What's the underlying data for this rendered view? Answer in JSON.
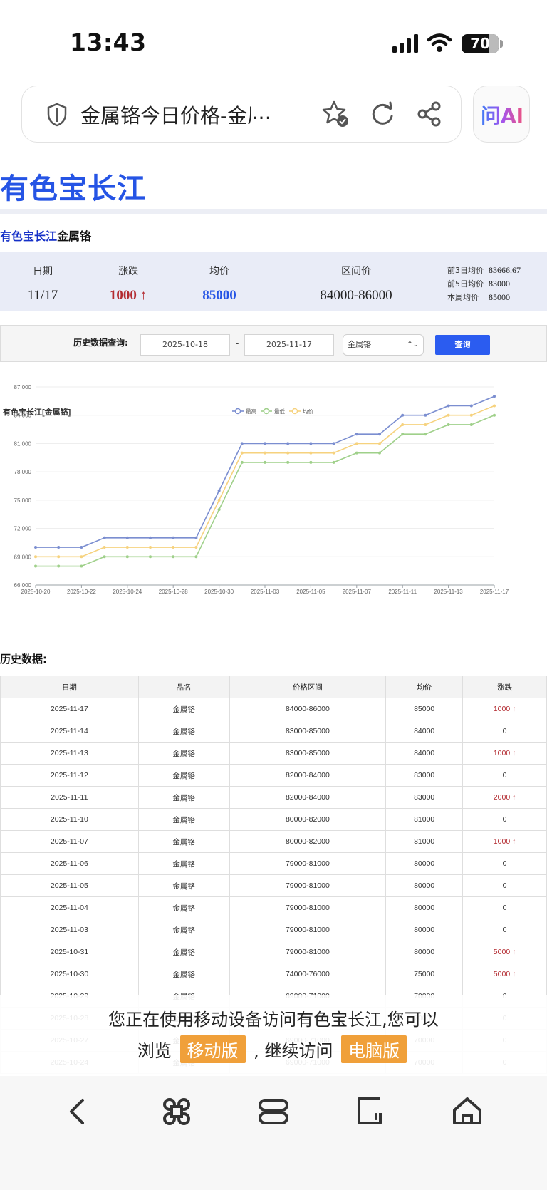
{
  "status": {
    "time": "13:43",
    "battery": "70"
  },
  "browser": {
    "page_title": "金属铬今日价格-金属",
    "title_ellipsis": "…",
    "ai_label": "问AI"
  },
  "site": {
    "logo": "有色宝长江"
  },
  "breadcrumb": {
    "site_link": "有色宝长江",
    "product": "金属铬"
  },
  "summary": {
    "date_label": "日期",
    "date": "11/17",
    "change_label": "涨跌",
    "change": "1000 ↑",
    "avg_label": "均价",
    "avg": "85000",
    "range_label": "区间价",
    "range": "84000-86000",
    "stats": [
      {
        "label": "前3日均价",
        "value": "83666.67"
      },
      {
        "label": "前5日均价",
        "value": "83000"
      },
      {
        "label": "本周均价",
        "value": "85000"
      }
    ]
  },
  "query": {
    "label": "历史数据查询:",
    "start": "2025-10-18",
    "dash": "-",
    "end": "2025-11-17",
    "product": "金属铬",
    "button": "查询"
  },
  "chart_data": {
    "type": "line",
    "title": "有色宝长江[金属铬]",
    "x": [
      "2025-10-20",
      "2025-10-21",
      "2025-10-22",
      "2025-10-23",
      "2025-10-24",
      "2025-10-27",
      "2025-10-28",
      "2025-10-29",
      "2025-10-30",
      "2025-10-31",
      "2025-11-03",
      "2025-11-04",
      "2025-11-05",
      "2025-11-06",
      "2025-11-07",
      "2025-11-10",
      "2025-11-11",
      "2025-11-12",
      "2025-11-13",
      "2025-11-14",
      "2025-11-17"
    ],
    "x_ticks": [
      "2025-10-20",
      "2025-10-22",
      "2025-10-24",
      "2025-10-28",
      "2025-10-30",
      "2025-11-03",
      "2025-11-05",
      "2025-11-07",
      "2025-11-11",
      "2025-11-13",
      "2025-11-17"
    ],
    "ylim": [
      66000,
      87000
    ],
    "y_ticks": [
      "66,000",
      "69,000",
      "72,000",
      "75,000",
      "78,000",
      "81,000",
      "84,000",
      "87,000"
    ],
    "legend_position": "top-center",
    "series": [
      {
        "name": "最高",
        "color": "#7b8ed0",
        "values": [
          70000,
          70000,
          70000,
          71000,
          71000,
          71000,
          71000,
          71000,
          76000,
          81000,
          81000,
          81000,
          81000,
          81000,
          82000,
          82000,
          84000,
          84000,
          85000,
          85000,
          86000
        ]
      },
      {
        "name": "最低",
        "color": "#9fd08a",
        "values": [
          68000,
          68000,
          68000,
          69000,
          69000,
          69000,
          69000,
          69000,
          74000,
          79000,
          79000,
          79000,
          79000,
          79000,
          80000,
          80000,
          82000,
          82000,
          83000,
          83000,
          84000
        ]
      },
      {
        "name": "均价",
        "color": "#f6d27e",
        "values": [
          69000,
          69000,
          69000,
          70000,
          70000,
          70000,
          70000,
          70000,
          75000,
          80000,
          80000,
          80000,
          80000,
          80000,
          81000,
          81000,
          83000,
          83000,
          84000,
          84000,
          85000
        ]
      }
    ]
  },
  "history": {
    "title": "历史数据:",
    "headers": [
      "日期",
      "品名",
      "价格区间",
      "均价",
      "涨跌"
    ],
    "rows": [
      [
        "2025-11-17",
        "金属铬",
        "84000-86000",
        "85000",
        "1000 ↑"
      ],
      [
        "2025-11-14",
        "金属铬",
        "83000-85000",
        "84000",
        "0"
      ],
      [
        "2025-11-13",
        "金属铬",
        "83000-85000",
        "84000",
        "1000 ↑"
      ],
      [
        "2025-11-12",
        "金属铬",
        "82000-84000",
        "83000",
        "0"
      ],
      [
        "2025-11-11",
        "金属铬",
        "82000-84000",
        "83000",
        "2000 ↑"
      ],
      [
        "2025-11-10",
        "金属铬",
        "80000-82000",
        "81000",
        "0"
      ],
      [
        "2025-11-07",
        "金属铬",
        "80000-82000",
        "81000",
        "1000 ↑"
      ],
      [
        "2025-11-06",
        "金属铬",
        "79000-81000",
        "80000",
        "0"
      ],
      [
        "2025-11-05",
        "金属铬",
        "79000-81000",
        "80000",
        "0"
      ],
      [
        "2025-11-04",
        "金属铬",
        "79000-81000",
        "80000",
        "0"
      ],
      [
        "2025-11-03",
        "金属铬",
        "79000-81000",
        "80000",
        "0"
      ],
      [
        "2025-10-31",
        "金属铬",
        "79000-81000",
        "80000",
        "5000 ↑"
      ],
      [
        "2025-10-30",
        "金属铬",
        "74000-76000",
        "75000",
        "5000 ↑"
      ],
      [
        "2025-10-29",
        "金属铬",
        "69000-71000",
        "70000",
        "0"
      ],
      [
        "2025-10-28",
        "金属铬",
        "69000-71000",
        "70000",
        "0"
      ],
      [
        "2025-10-27",
        "金属铬",
        "69000-71000",
        "70000",
        "0"
      ],
      [
        "2025-10-24",
        "金属铬",
        "69000-71000",
        "70000",
        "0"
      ]
    ]
  },
  "notice": {
    "line1": "您正在使用移动设备访问有色宝长江,您可以",
    "browse": "浏览",
    "mobile_btn": "移动版",
    "comma": ",",
    "continue": "继续访问",
    "pc_btn": "电脑版"
  },
  "navbar": {
    "icons": [
      "back-icon",
      "command-icon",
      "tabs-icon",
      "edit-icon",
      "home-icon"
    ]
  }
}
